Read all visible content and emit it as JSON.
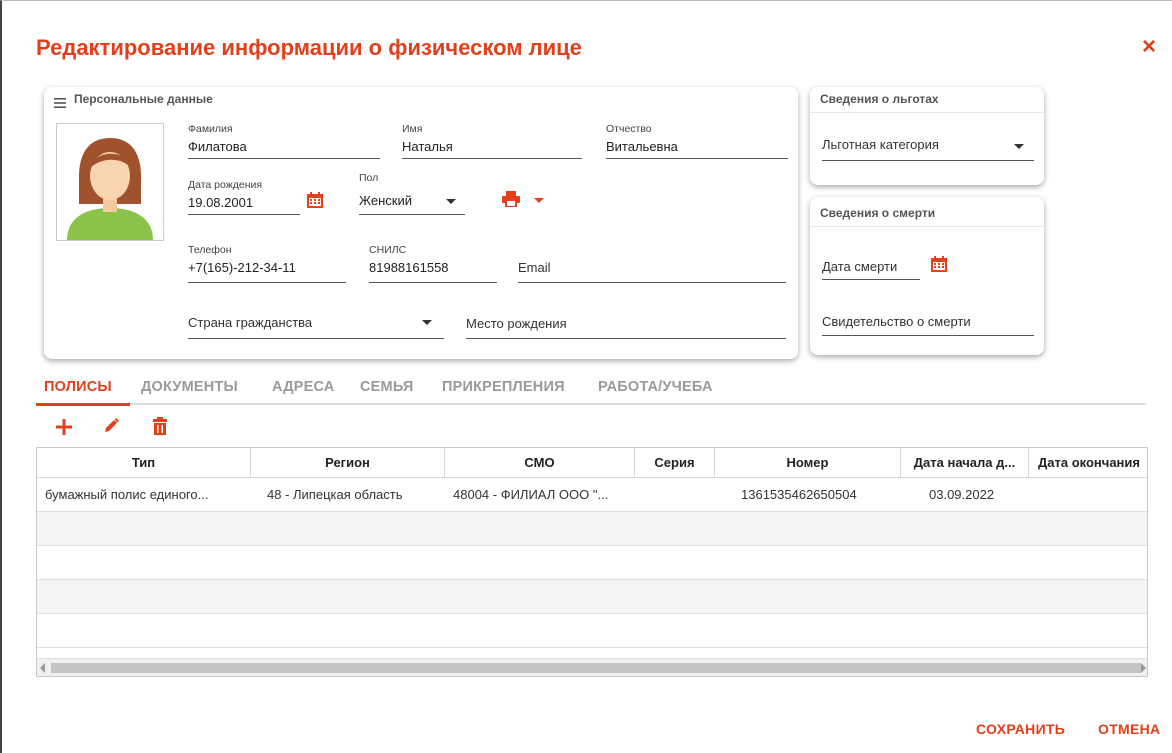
{
  "dialog": {
    "title": "Редактирование информации о физическом лице",
    "close_label": "×"
  },
  "personal": {
    "header": "Персональные данные",
    "surname_label": "Фамилия",
    "surname": "Филатова",
    "name_label": "Имя",
    "name": "Наталья",
    "patronymic_label": "Отчество",
    "patronymic": "Витальевна",
    "birthdate_label": "Дата рождения",
    "birthdate": "19.08.2001",
    "gender_label": "Пол",
    "gender": "Женский",
    "phone_label": "Телефон",
    "phone": "+7(165)-212-34-11",
    "snils_label": "СНИЛС",
    "snils": "81988161558",
    "email_placeholder": "Email",
    "citizenship_placeholder": "Страна гражданства",
    "birthplace_placeholder": "Место рождения"
  },
  "benefits": {
    "header": "Сведения о льготах",
    "category_placeholder": "Льготная категория"
  },
  "death": {
    "header": "Сведения о смерти",
    "date_placeholder": "Дата смерти",
    "certificate_placeholder": "Свидетельство о смерти"
  },
  "tabs": [
    {
      "label": "ПОЛИСЫ",
      "active": true
    },
    {
      "label": "ДОКУМЕНТЫ",
      "active": false
    },
    {
      "label": "АДРЕСА",
      "active": false
    },
    {
      "label": "СЕМЬЯ",
      "active": false
    },
    {
      "label": "ПРИКРЕПЛЕНИЯ",
      "active": false
    },
    {
      "label": "РАБОТА/УЧЕБА",
      "active": false
    }
  ],
  "toolbar": {
    "add_icon": "plus-icon",
    "edit_icon": "pencil-icon",
    "delete_icon": "trash-icon"
  },
  "grid": {
    "columns": [
      "Тип",
      "Регион",
      "СМО",
      "Серия",
      "Номер",
      "Дата начала д...",
      "Дата окончания"
    ],
    "rows": [
      [
        "бумажный полис единого...",
        "48 - Липецкая область",
        "48004 - ФИЛИАЛ ООО \"...",
        "",
        "1361535462650504",
        "03.09.2022",
        ""
      ]
    ]
  },
  "footer": {
    "save_label": "СОХРАНИТЬ",
    "cancel_label": "ОТМЕНА"
  },
  "colors": {
    "accent": "#e0401b",
    "tab_inactive": "#9a9a9a"
  }
}
